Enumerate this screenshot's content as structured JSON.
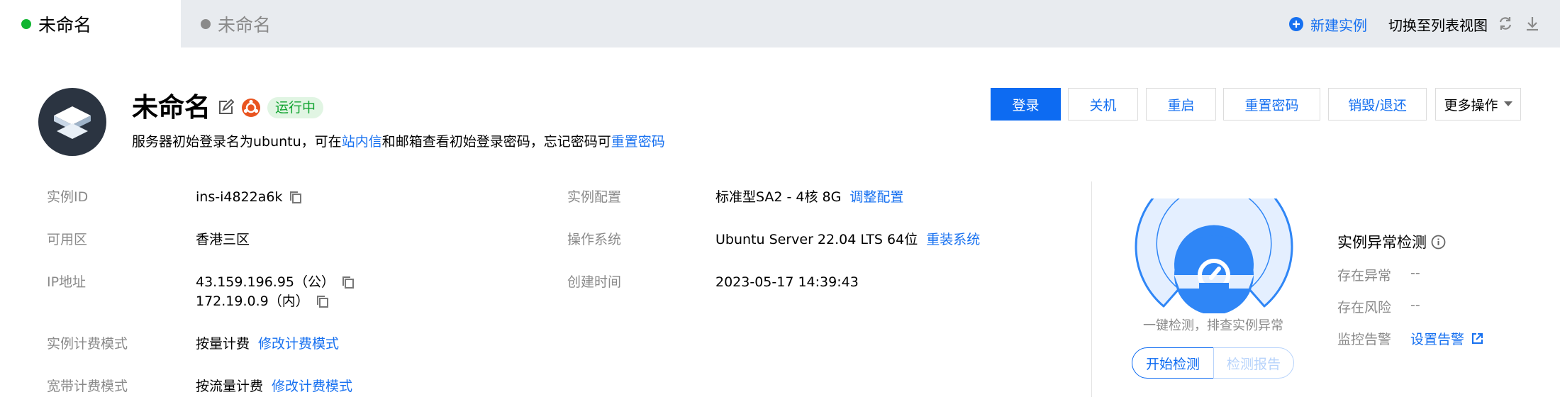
{
  "tabs": [
    {
      "label": "未命名",
      "active": true,
      "status_color": "#10b531"
    },
    {
      "label": "未命名",
      "active": false,
      "status_color": "#8a8a8a"
    }
  ],
  "toolbar": {
    "new_instance": "新建实例",
    "switch_list": "切换至列表视图",
    "refresh_icon": "refresh-icon",
    "download_icon": "download-icon"
  },
  "instance": {
    "name": "未命名",
    "os_badge_icon": "ubuntu-icon",
    "status": "运行中",
    "status_color": "#10a32f",
    "notice_prefix": "服务器初始登录名为ubuntu，可在",
    "notice_link1": "站内信",
    "notice_middle": "和邮箱查看初始登录密码，忘记密码可",
    "notice_link2": "重置密码"
  },
  "actions": {
    "login": "登录",
    "shutdown": "关机",
    "restart": "重启",
    "reset_password": "重置密码",
    "destroy": "销毁/退还",
    "more": "更多操作"
  },
  "details": {
    "instance_id_label": "实例ID",
    "instance_id": "ins-i4822a6k",
    "zone_label": "可用区",
    "zone": "香港三区",
    "ip_label": "IP地址",
    "ip_public": "43.159.196.95（公）",
    "ip_private": "172.19.0.9（内）",
    "billing_label": "实例计费模式",
    "billing": "按量计费",
    "billing_link": "修改计费模式",
    "bandwidth_label": "宽带计费模式",
    "bandwidth": "按流量计费",
    "bandwidth_link": "修改计费模式",
    "config_label": "实例配置",
    "config": "标准型SA2 - 4核 8G",
    "config_link": "调整配置",
    "os_label": "操作系统",
    "os": "Ubuntu Server 22.04 LTS 64位",
    "os_link": "重装系统",
    "created_label": "创建时间",
    "created": "2023-05-17 14:39:43"
  },
  "detection": {
    "hint": "一键检测，排查实例异常",
    "start": "开始检测",
    "report": "检测报告",
    "title": "实例异常检测",
    "exception_label": "存在异常",
    "exception_value": "--",
    "risk_label": "存在风险",
    "risk_value": "--",
    "alarm_label": "监控告警",
    "alarm_link": "设置告警"
  },
  "colors": {
    "accent": "#0d6bf2",
    "link": "#1670f0",
    "gauge_fill": "#e4efff",
    "gauge_stroke": "#2f86f6"
  }
}
